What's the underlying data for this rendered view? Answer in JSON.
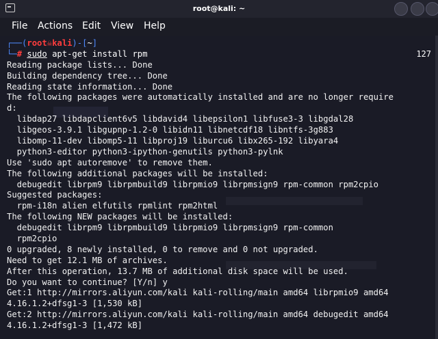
{
  "window": {
    "title": "root@kali: ~"
  },
  "menu": [
    "File",
    "Actions",
    "Edit",
    "View",
    "Help"
  ],
  "prompt": {
    "user": "root",
    "host": "kali",
    "path": "~",
    "hash": "#",
    "sudo": "sudo",
    "command": " apt-get install rpm",
    "counter": "127"
  },
  "output": [
    "Reading package lists... Done",
    "Building dependency tree... Done",
    "Reading state information... Done",
    "The following packages were automatically installed and are no longer require",
    "d:",
    "  libdap27 libdapclient6v5 libdavid4 libepsilon1 libfuse3-3 libgdal28",
    "  libgeos-3.9.1 libgupnp-1.2-0 libidn11 libnetcdf18 libntfs-3g883",
    "  libomp-11-dev libomp5-11 libproj19 liburcu6 libx265-192 libyara4",
    "  python3-editor python3-ipython-genutils python3-pylnk",
    "Use 'sudo apt autoremove' to remove them.",
    "The following additional packages will be installed:",
    "  debugedit librpm9 librpmbuild9 librpmio9 librpmsign9 rpm-common rpm2cpio",
    "Suggested packages:",
    "  rpm-i18n alien elfutils rpmlint rpm2html",
    "The following NEW packages will be installed:",
    "  debugedit librpm9 librpmbuild9 librpmio9 librpmsign9 rpm-common",
    "  rpm2cpio",
    "0 upgraded, 8 newly installed, 0 to remove and 0 not upgraded.",
    "Need to get 12.1 MB of archives.",
    "After this operation, 13.7 MB of additional disk space will be used.",
    "Do you want to continue? [Y/n] y",
    "Get:1 http://mirrors.aliyun.com/kali kali-rolling/main amd64 librpmio9 amd64",
    "4.16.1.2+dfsg1-3 [1,530 kB]",
    "Get:2 http://mirrors.aliyun.com/kali kali-rolling/main amd64 debugedit amd64",
    "4.16.1.2+dfsg1-3 [1,472 kB]"
  ]
}
